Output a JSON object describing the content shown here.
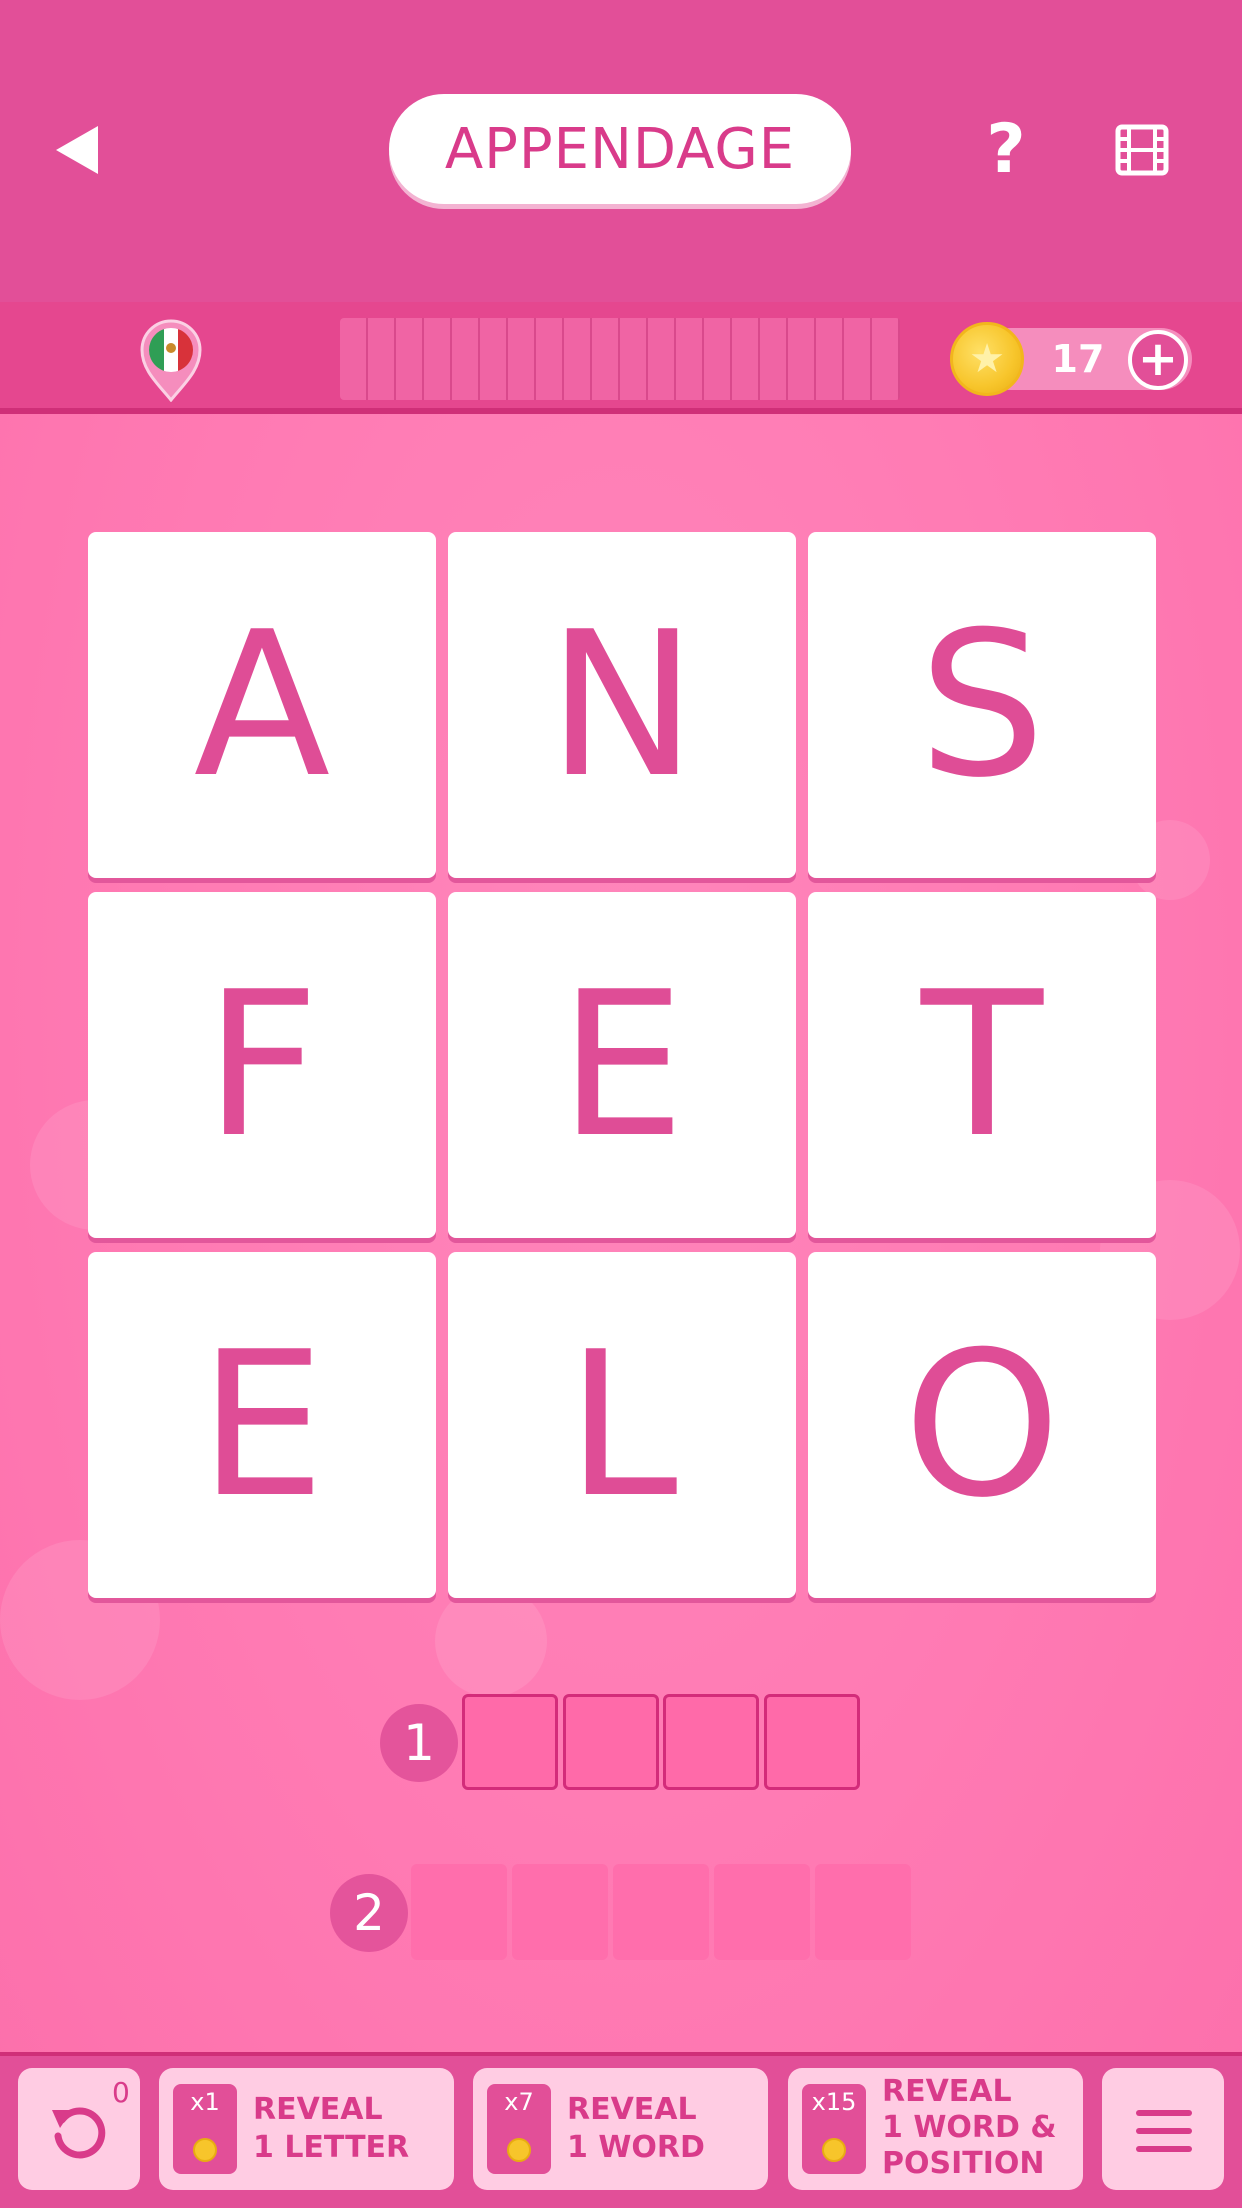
{
  "header": {
    "title": "APPENDAGE",
    "back_icon": "back-arrow-icon",
    "help_label": "?",
    "video_icon": "film-icon"
  },
  "status": {
    "language_flag_icon": "mexico-flag-pin-icon",
    "progress_segments_filled": 0,
    "coins": "17",
    "add_coins_label": "+"
  },
  "grid": {
    "letters": [
      "A",
      "N",
      "S",
      "F",
      "E",
      "T",
      "E",
      "L",
      "O"
    ]
  },
  "answers": [
    {
      "number": "1",
      "length": 4
    },
    {
      "number": "2",
      "length": 5
    }
  ],
  "toolbar": {
    "undo_count": "0",
    "hints": [
      {
        "cost": "x1",
        "label_line1": "REVEAL",
        "label_line2": "1 LETTER",
        "label_line3": ""
      },
      {
        "cost": "x7",
        "label_line1": "REVEAL",
        "label_line2": "1 WORD",
        "label_line3": ""
      },
      {
        "cost": "x15",
        "label_line1": "REVEAL",
        "label_line2": "1 WORD &",
        "label_line3": "POSITION"
      }
    ],
    "menu_icon": "hamburger-menu-icon"
  },
  "colors": {
    "accent": "#e24f98",
    "tile_letter": "#df4d96",
    "background": "#ff7fb6"
  }
}
